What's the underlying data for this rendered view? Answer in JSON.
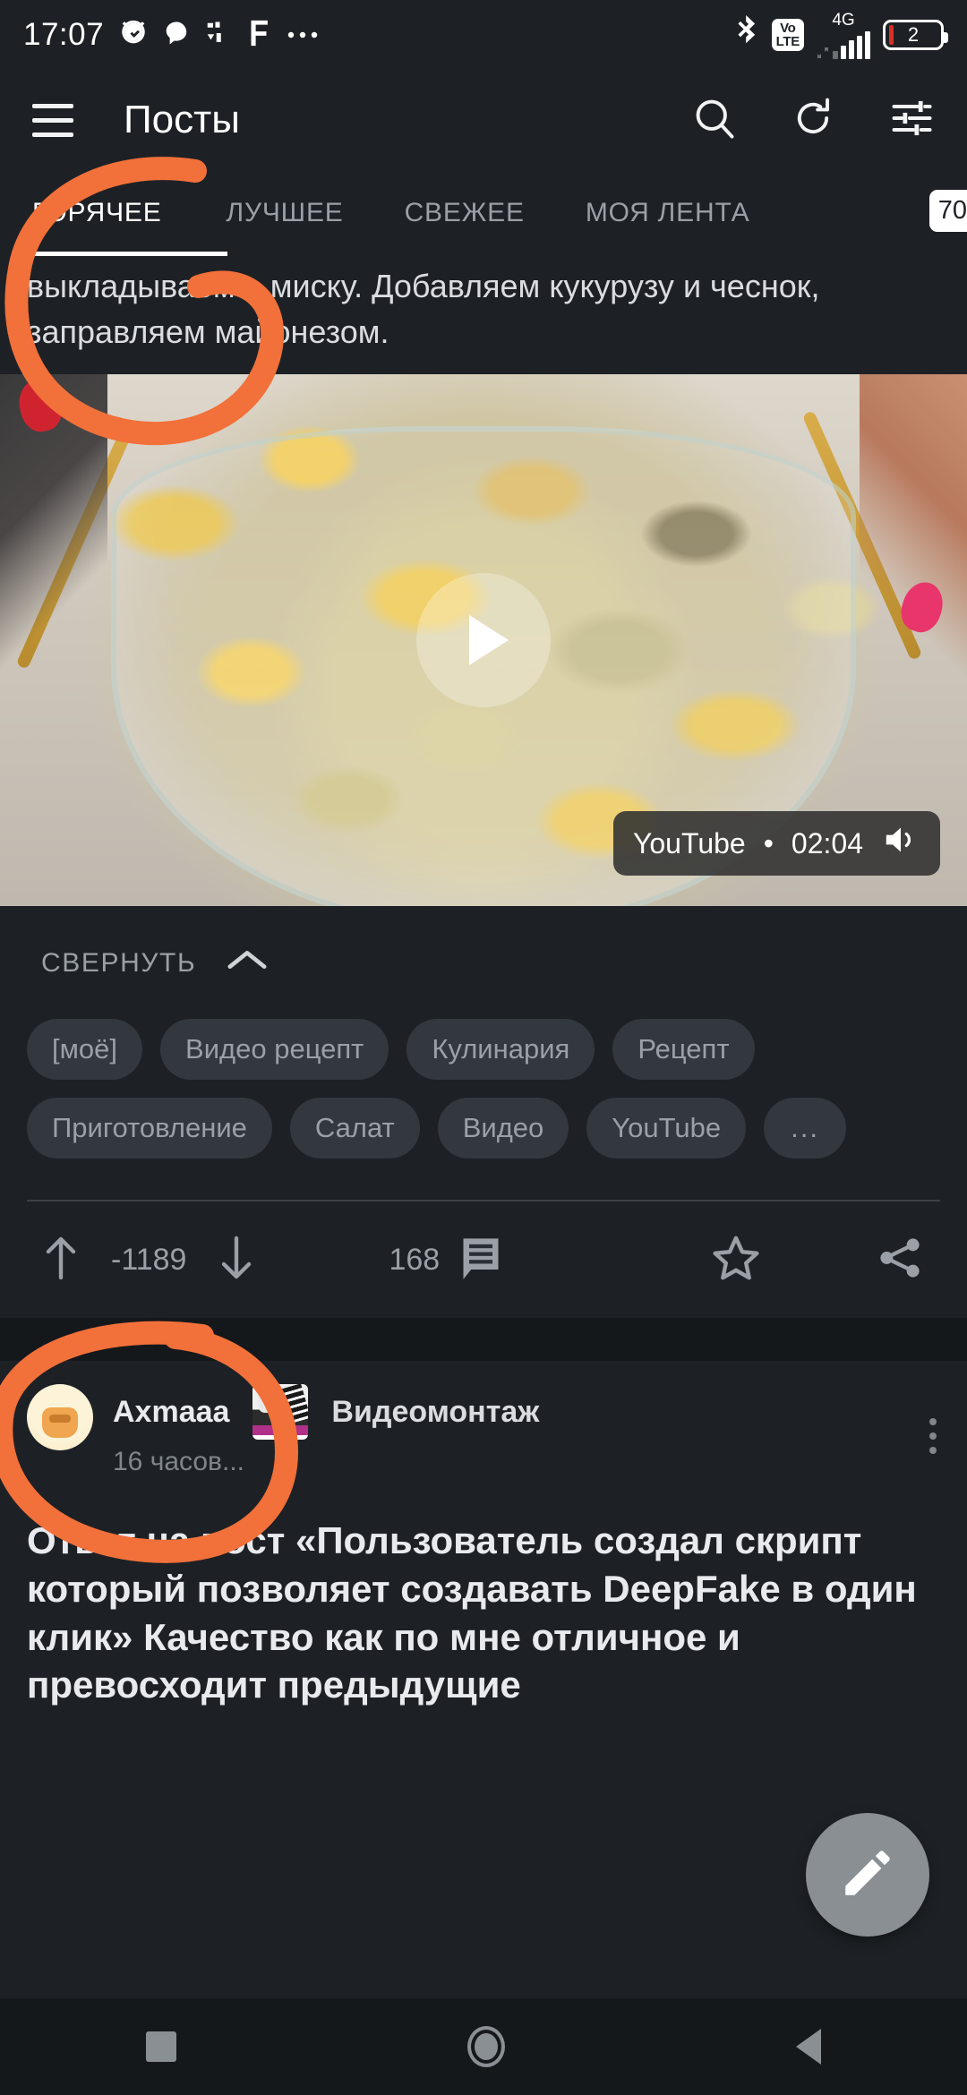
{
  "statusbar": {
    "time": "17:07",
    "icons_left": [
      "alarm-icon",
      "chat-bubble-icon",
      "app-glyph-icon",
      "f-app-icon",
      "more-dots-icon"
    ],
    "icons_right": [
      "bluetooth-icon",
      "volte-icon",
      "4g-icon",
      "signal-icon",
      "battery-icon"
    ],
    "volte_top": "Vo",
    "volte_bottom": "LTE",
    "network": "4G",
    "battery_level": "2"
  },
  "appbar": {
    "menu_icon": "hamburger-menu-icon",
    "title": "Посты",
    "actions": [
      {
        "name": "search-icon",
        "label": "search"
      },
      {
        "name": "refresh-icon",
        "label": "refresh"
      },
      {
        "name": "filter-icon",
        "label": "filter"
      }
    ]
  },
  "tabs": {
    "items": [
      {
        "label": "ГОРЯЧЕЕ",
        "active": true
      },
      {
        "label": "ЛУЧШЕЕ",
        "active": false
      },
      {
        "label": "СВЕЖЕЕ",
        "active": false
      },
      {
        "label": "МОЯ ЛЕНТА",
        "active": false
      }
    ],
    "badge": "70"
  },
  "post1": {
    "body_text": "выкладываем в миску. Добавляем кукурузу и чеснок, заправляем майонезом.",
    "video": {
      "source": "YouTube",
      "separator": "•",
      "duration": "02:04",
      "play_icon": "play-icon",
      "sound_icon": "volume-on-icon",
      "alt": "Салат с кукурузой в стеклянной миске"
    },
    "collapse_label": "СВЕРНУТЬ",
    "collapse_icon": "chevron-up-icon",
    "tags": [
      "[моё]",
      "Видео рецепт",
      "Кулинария",
      "Рецепт",
      "Приготовление",
      "Салат",
      "Видео",
      "YouTube",
      "..."
    ],
    "actions": {
      "upvote_icon": "arrow-up-icon",
      "rating": "-1189",
      "downvote_icon": "arrow-down-icon",
      "comments_count": "168",
      "comments_icon": "comment-icon",
      "favorite_icon": "star-icon",
      "share_icon": "share-icon"
    }
  },
  "post2": {
    "author": "Axmaaa",
    "community": "Видеомонтаж",
    "community_icon": "film-reel-icon",
    "avatar_icon": "user-avatar",
    "timestamp": "16 часов...",
    "menu_icon": "kebab-menu-icon",
    "title": "Ответ на пост «Пользователь создал скрипт который позволяет создавать DeepFake в один клик» Качество как по мне отличное и превосходит предыдущие"
  },
  "fab": {
    "icon": "pencil-edit-icon",
    "label": "Создать пост"
  },
  "navbar": {
    "recents_icon": "recents-square-icon",
    "home_icon": "home-circle-icon",
    "back_icon": "back-triangle-icon"
  },
  "annotations": {
    "circle1_target": "ГОРЯЧЕЕ",
    "circle2_target": "-1189",
    "color": "#f2703a"
  },
  "colors": {
    "background": "#1d2125",
    "surface_dark": "#15181b",
    "text_primary": "#e8eaed",
    "text_secondary": "#9aa0a6",
    "chip_bg": "#32383d",
    "annotation": "#f2703a",
    "badge_bg": "#ffffff"
  }
}
